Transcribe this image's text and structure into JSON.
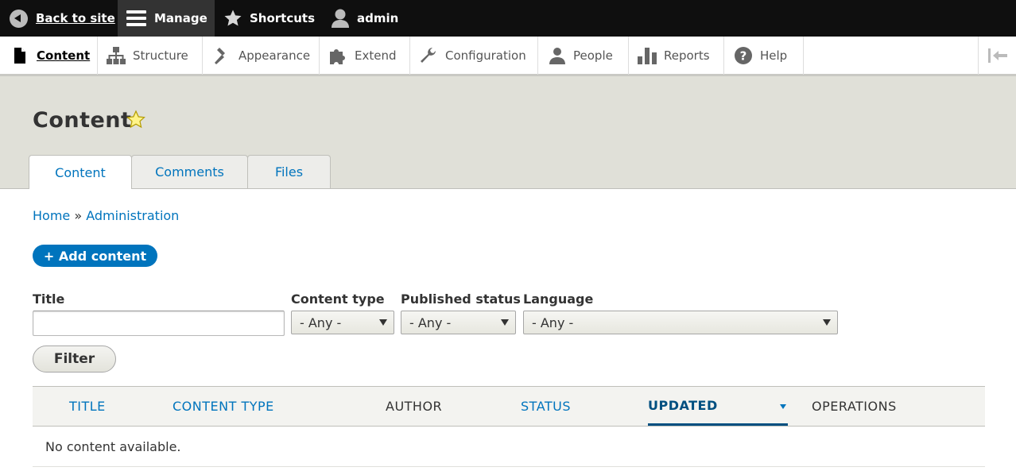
{
  "toolbar": {
    "back_label": "Back to site",
    "manage_label": "Manage",
    "shortcuts_label": "Shortcuts",
    "user_label": "admin"
  },
  "tray": {
    "items": [
      {
        "label": "Content",
        "icon": "file-icon"
      },
      {
        "label": "Structure",
        "icon": "sitemap-icon"
      },
      {
        "label": "Appearance",
        "icon": "paint-icon"
      },
      {
        "label": "Extend",
        "icon": "puzzle-icon"
      },
      {
        "label": "Configuration",
        "icon": "wrench-icon"
      },
      {
        "label": "People",
        "icon": "people-icon"
      },
      {
        "label": "Reports",
        "icon": "bar-chart-icon"
      },
      {
        "label": "Help",
        "icon": "help-icon"
      }
    ]
  },
  "page": {
    "title": "Content",
    "tabs": [
      {
        "label": "Content"
      },
      {
        "label": "Comments"
      },
      {
        "label": "Files"
      }
    ]
  },
  "breadcrumb": {
    "home": "Home",
    "separator": "»",
    "admin": "Administration"
  },
  "actions": {
    "add_content": "+ Add content"
  },
  "filters": {
    "title_label": "Title",
    "title_value": "",
    "content_type_label": "Content type",
    "content_type_value": "- Any -",
    "published_label": "Published status",
    "published_value": "- Any -",
    "language_label": "Language",
    "language_value": "- Any -",
    "filter_button": "Filter"
  },
  "table": {
    "headers": [
      "TITLE",
      "CONTENT TYPE",
      "AUTHOR",
      "STATUS",
      "UPDATED",
      "OPERATIONS"
    ],
    "empty_message": "No content available."
  },
  "colors": {
    "link": "#0074bd",
    "toolbar_bg": "#0f0f0f",
    "header_bg": "#e0e0d8"
  }
}
